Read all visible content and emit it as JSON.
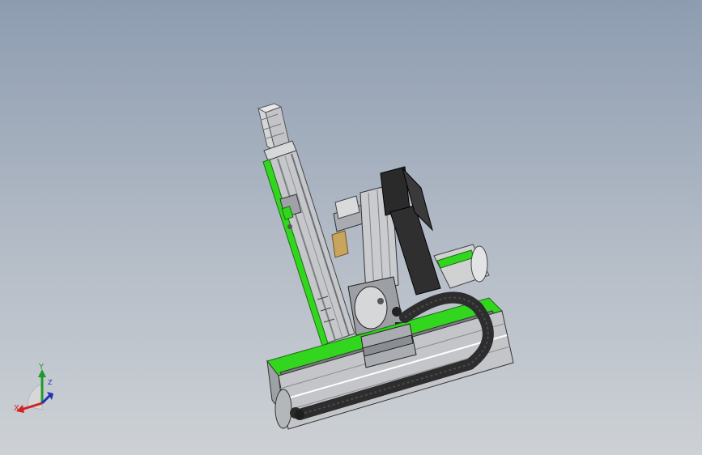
{
  "viewport": {
    "background_top": "#8d9cb0",
    "background_bottom": "#cdd1d5"
  },
  "model": {
    "accent_color": "#33d61e",
    "body_color": "#b9bcbf",
    "dark_color": "#2a2a2a"
  },
  "triad": {
    "x_label": "X",
    "y_label": "Y",
    "z_label": "Z",
    "x_color": "#d42020",
    "y_color": "#1f9a2a",
    "z_color": "#2030b0"
  }
}
